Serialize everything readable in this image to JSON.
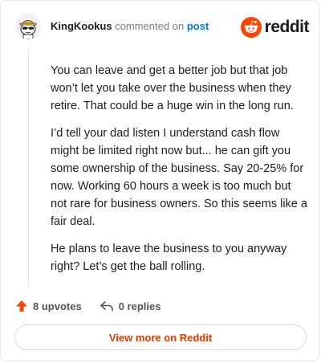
{
  "header": {
    "author": "KingKookus",
    "verb": "commented on",
    "post_link": "post",
    "brand": "reddit"
  },
  "comment": {
    "paragraphs": [
      "You can leave and get a better job but that job won’t let you take over the business when they retire. That could be a huge win in the long run.",
      "I’d tell your dad listen I understand cash flow might be limited right now but... he can gift you some ownership of the business. Say 20-25% for now. Working 60 hours a week is too much but not rare for business owners. So this seems like a fair deal.",
      "He plans to leave the business to you anyway right? Let’s get the ball rolling."
    ]
  },
  "actions": {
    "upvotes": "8 upvotes",
    "replies": "0 replies"
  },
  "footer": {
    "view_more": "View more on Reddit"
  },
  "colors": {
    "reddit_orange": "#ff4500",
    "link_blue": "#0079d3",
    "cta_text": "#d93a00"
  },
  "icons": {
    "avatar": "snoo-avatar-with-sunglasses",
    "upvote": "upvote-arrow-icon",
    "reply": "reply-arrow-icon"
  }
}
